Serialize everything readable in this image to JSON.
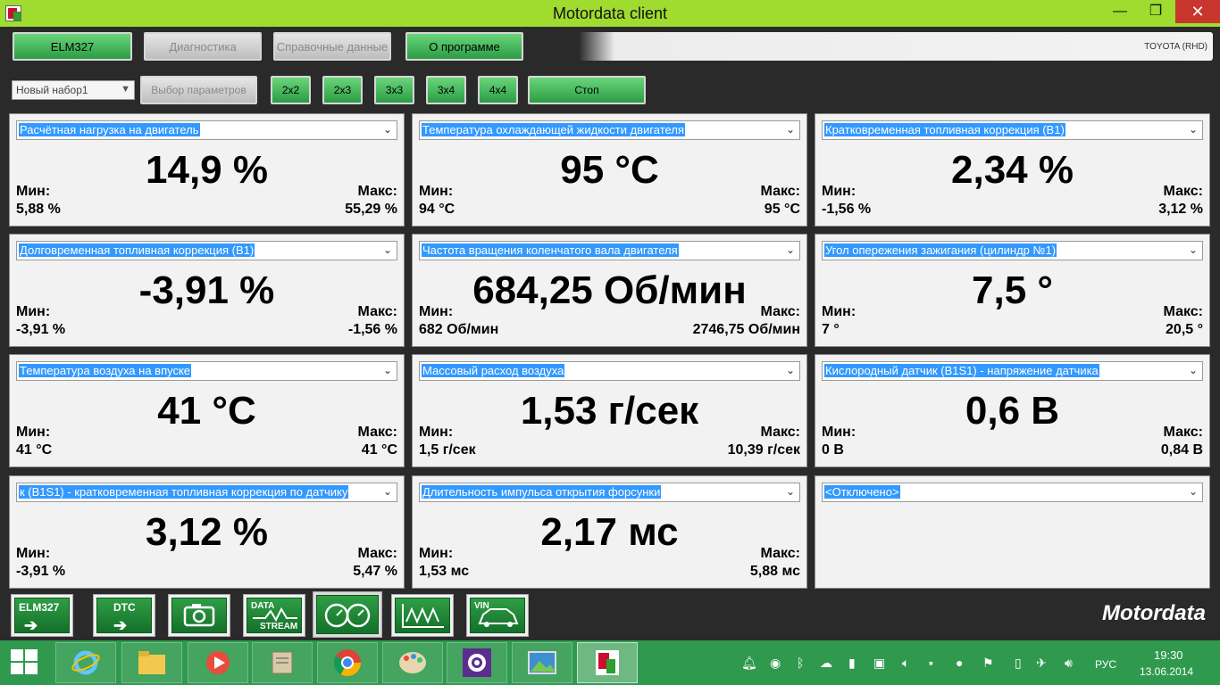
{
  "window": {
    "title": "Motordata client",
    "minimize": "—",
    "maximize": "❐",
    "close": "✕"
  },
  "menu": {
    "items": [
      {
        "label": "ELM327",
        "enabled": true
      },
      {
        "label": "Диагностика",
        "enabled": false
      },
      {
        "label": "Справочные данные",
        "enabled": false
      },
      {
        "label": "О программе",
        "enabled": true
      }
    ],
    "vehicle": "TOYOTA (RHD)"
  },
  "toolbar": {
    "set_select": "Новый набор1",
    "select_params": "Выбор параметров",
    "grid_2x2": "2x2",
    "grid_2x3": "2x3",
    "grid_3x3": "3x3",
    "grid_3x4": "3x4",
    "grid_4x4": "4x4",
    "stop": "Стоп"
  },
  "labels": {
    "min": "Мин:",
    "max": "Макс:"
  },
  "gauges": [
    {
      "param": "Расчётная нагрузка на двигатель",
      "value": "14,9 %",
      "min": "5,88 %",
      "max": "55,29 %"
    },
    {
      "param": "Температура охлаждающей жидкости двигателя",
      "value": "95 °C",
      "min": "94 °C",
      "max": "95 °C"
    },
    {
      "param": "Кратковременная топливная коррекция (B1)",
      "value": "2,34 %",
      "min": "-1,56 %",
      "max": "3,12 %"
    },
    {
      "param": "Долговременная топливная коррекция (B1)",
      "value": "-3,91 %",
      "min": "-3,91 %",
      "max": "-1,56 %"
    },
    {
      "param": "Частота вращения коленчатого вала двигателя",
      "value": "684,25 Об/мин",
      "min": "682 Об/мин",
      "max": "2746,75 Об/мин"
    },
    {
      "param": "Угол опережения зажигания (цилиндр №1)",
      "value": "7,5 °",
      "min": "7 °",
      "max": "20,5 °"
    },
    {
      "param": "Температура воздуха на впуске",
      "value": "41 °C",
      "min": "41 °C",
      "max": "41 °C"
    },
    {
      "param": "Массовый расход воздуха",
      "value": "1,53 г/сек",
      "min": "1,5 г/сек",
      "max": "10,39 г/сек"
    },
    {
      "param": "Кислородный датчик (B1S1) - напряжение датчика",
      "value": "0,6 В",
      "min": "0 В",
      "max": "0,84 В"
    },
    {
      "param": "к (B1S1) - кратковременная топливная коррекция по датчику",
      "value": "3,12 %",
      "min": "-3,91 %",
      "max": "5,47 %"
    },
    {
      "param": "Длительность импульса открытия форсунки",
      "value": "2,17 мс",
      "min": "1,53 мс",
      "max": "5,88 мс"
    },
    {
      "param": "<Отключено>"
    }
  ],
  "bottom_nav": {
    "elm327": "ELM327",
    "dtc": "DTC",
    "data": "DATA",
    "stream": "STREAM",
    "vin": "VIN",
    "brand": "Motordata"
  },
  "taskbar": {
    "lang": "РУС",
    "time": "19:30",
    "date": "13.06.2014"
  }
}
